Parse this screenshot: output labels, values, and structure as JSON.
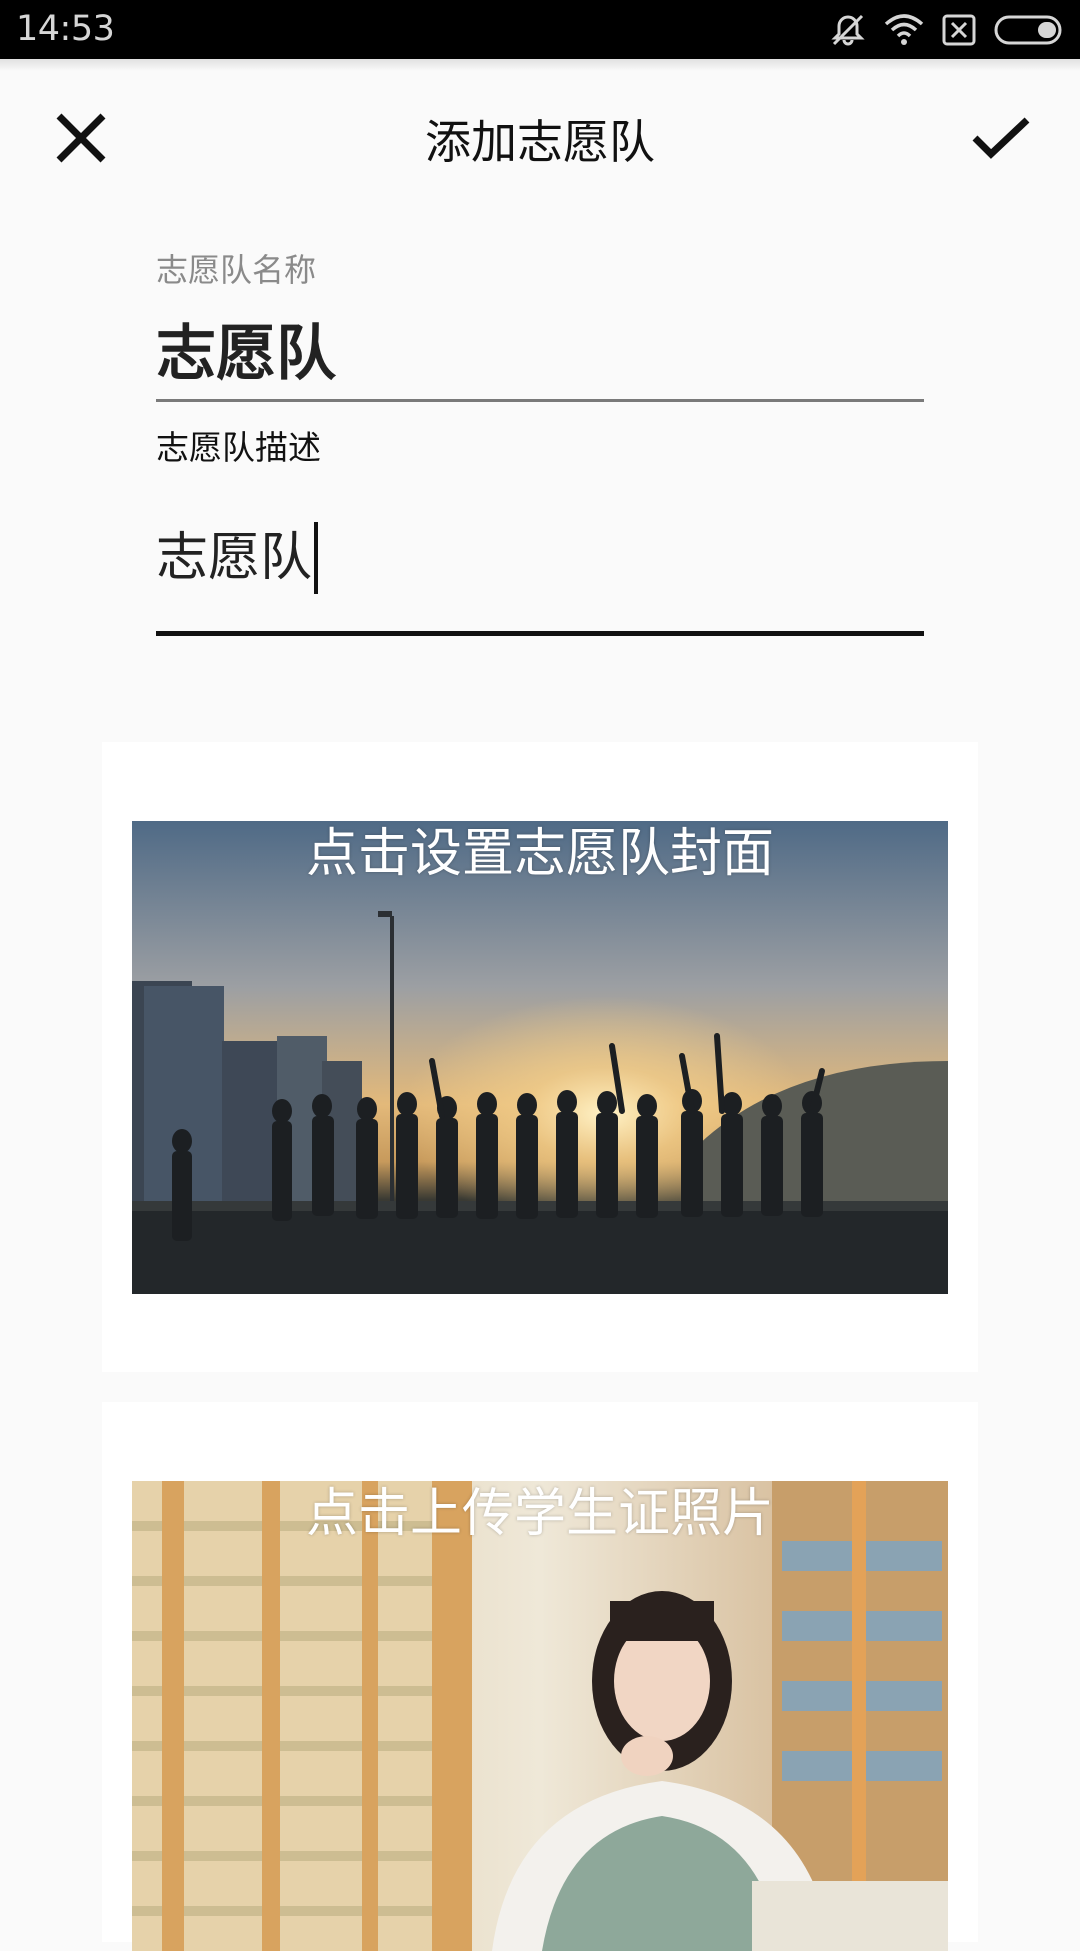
{
  "status_bar": {
    "time": "14:53",
    "icons": [
      "vibrate-off-icon",
      "wifi-icon",
      "sim-off-icon",
      "battery-icon"
    ]
  },
  "toolbar": {
    "title": "添加志愿队",
    "close_icon": "close-icon",
    "confirm_icon": "check-icon"
  },
  "form": {
    "name_label": "志愿队名称",
    "name_value": "志愿队",
    "description_label": "志愿队描述",
    "description_value": "志愿队"
  },
  "cover_card": {
    "caption": "点击设置志愿队封面"
  },
  "student_card": {
    "caption": "点击上传学生证照片"
  },
  "colors": {
    "background": "#fafafa",
    "status_bar": "#000000",
    "text_primary": "#111111",
    "text_hint": "#8a8a8a"
  }
}
